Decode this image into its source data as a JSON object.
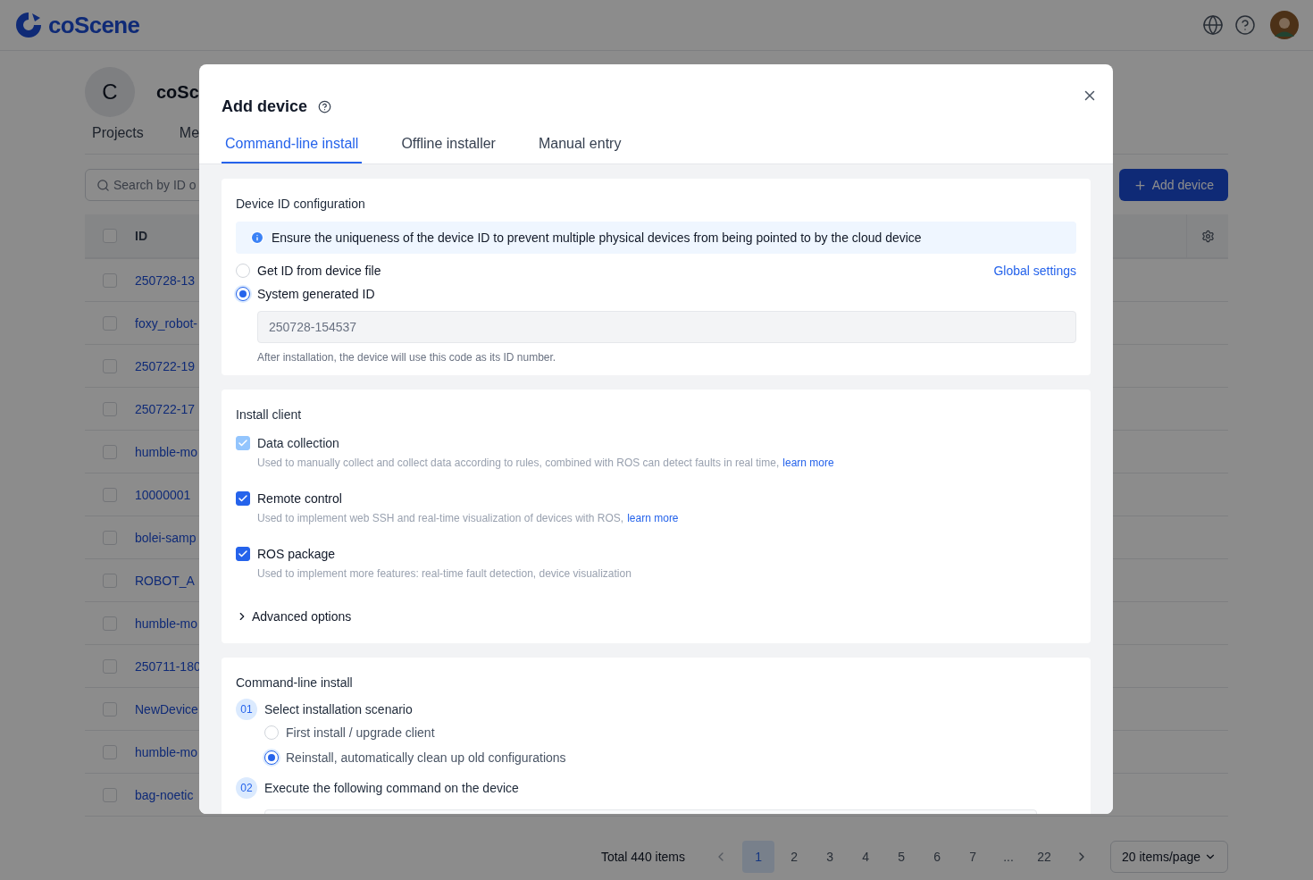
{
  "header": {
    "logo_text": "coScene"
  },
  "org": {
    "avatar_letter": "C",
    "name": "coSc"
  },
  "nav_tabs": [
    {
      "label": "Projects",
      "selected": false
    },
    {
      "label": "Me",
      "selected": false
    }
  ],
  "search": {
    "placeholder": "Search by ID o"
  },
  "add_button": "Add device",
  "table": {
    "columns": [
      "ID"
    ],
    "header_checked": false,
    "rows": [
      {
        "id": "250728-13",
        "checked": false
      },
      {
        "id": "foxy_robot-",
        "checked": false
      },
      {
        "id": "250722-19",
        "checked": false
      },
      {
        "id": "250722-17",
        "checked": false
      },
      {
        "id": "humble-mo",
        "checked": false
      },
      {
        "id": "10000001",
        "checked": false
      },
      {
        "id": "bolei-samp",
        "checked": false
      },
      {
        "id": "ROBOT_A",
        "checked": false
      },
      {
        "id": "humble-mo",
        "checked": false
      },
      {
        "id": "250711-180",
        "checked": false
      },
      {
        "id": "NewDevice",
        "checked": false
      },
      {
        "id": "humble-mo",
        "checked": false
      },
      {
        "id": "bag-noetic",
        "checked": false
      }
    ]
  },
  "pagination": {
    "total": "Total 440 items",
    "pages": [
      {
        "label": "1",
        "selected": true
      },
      {
        "label": "2",
        "selected": false
      },
      {
        "label": "3",
        "selected": false
      },
      {
        "label": "4",
        "selected": false
      },
      {
        "label": "5",
        "selected": false
      },
      {
        "label": "6",
        "selected": false
      },
      {
        "label": "7",
        "selected": false
      },
      {
        "label": "...",
        "selected": false
      },
      {
        "label": "22",
        "selected": false
      }
    ],
    "page_size": "20 items/page"
  },
  "dialog": {
    "title": "Add device",
    "tabs": [
      {
        "label": "Command-line install",
        "selected": true
      },
      {
        "label": "Offline installer",
        "selected": false
      },
      {
        "label": "Manual entry",
        "selected": false
      }
    ],
    "id_config": {
      "title": "Device ID configuration",
      "info": "Ensure the uniqueness of the device ID to prevent multiple physical devices from being pointed to by the cloud device",
      "options": [
        {
          "label": "Get ID from device file",
          "selected": false
        },
        {
          "label": "System generated ID",
          "selected": true
        }
      ],
      "global_settings": "Global settings",
      "id_value": "250728-154537",
      "hint": "After installation, the device will use this code as its ID number."
    },
    "install_client": {
      "title": "Install client",
      "items": [
        {
          "label": "Data collection",
          "description": "Used to manually collect and collect data according to rules, combined with ROS can detect faults in real time,",
          "link": "learn more",
          "checked": true,
          "disabled": true
        },
        {
          "label": "Remote control",
          "description": "Used to implement web SSH and real-time visualization of devices with ROS,",
          "link": "learn more",
          "checked": true,
          "disabled": false
        },
        {
          "label": "ROS package",
          "description": "Used to implement more features: real-time fault detection, device visualization",
          "checked": true,
          "disabled": false
        }
      ],
      "advanced": {
        "label": "Advanced options",
        "expanded": false
      }
    },
    "command_line": {
      "title": "Command-line install",
      "steps": [
        {
          "number": "01",
          "title": "Select installation scenario",
          "options": [
            {
              "label": "First install / upgrade client",
              "selected": false
            },
            {
              "label": "Reinstall, automatically clean up old configurations",
              "selected": true
            }
          ]
        },
        {
          "number": "02",
          "title": "Execute the following command on the device"
        }
      ]
    }
  }
}
